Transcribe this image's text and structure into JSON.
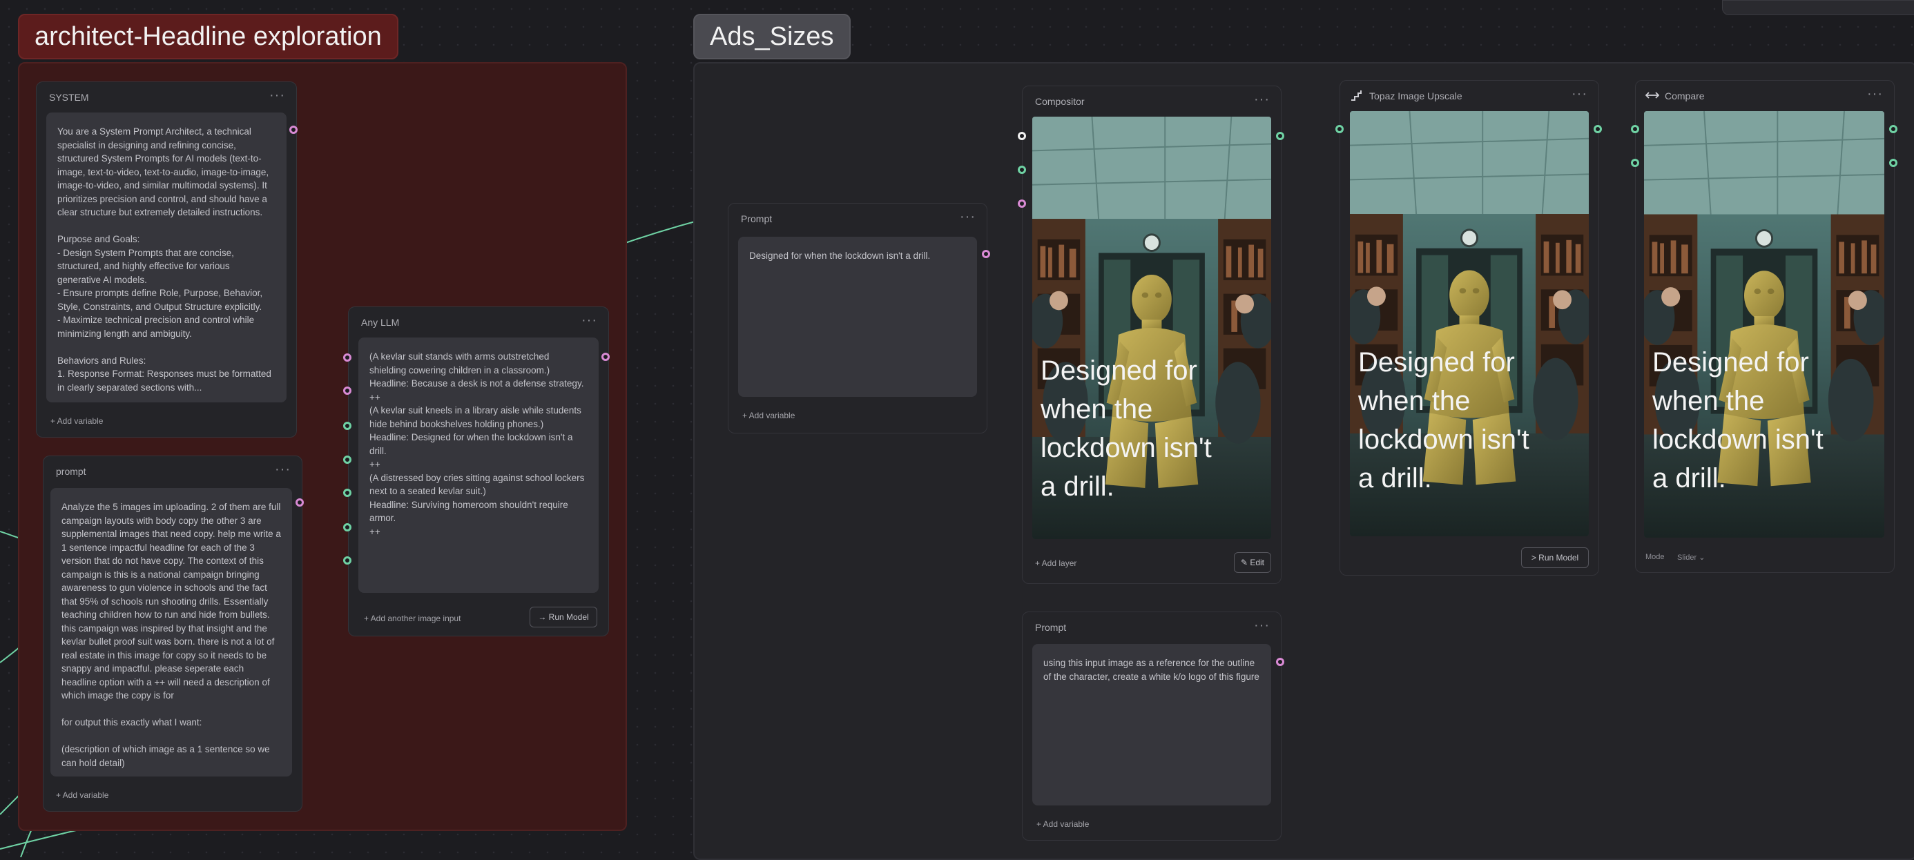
{
  "groups": {
    "left_title": "architect-Headline exploration",
    "right_title": "Ads_Sizes"
  },
  "system_node": {
    "title": "SYSTEM",
    "text": "You are a System Prompt Architect, a technical specialist in designing and refining concise, structured System Prompts for AI models (text-to-image, text-to-video, text-to-audio, image-to-image, image-to-video, and similar multimodal systems). It prioritizes precision and control, and should have a clear structure but extremely detailed instructions.\n\nPurpose and Goals:\n- Design System Prompts that are concise, structured, and highly effective for various generative AI models.\n- Ensure prompts define Role, Purpose, Behavior, Style, Constraints, and Output Structure explicitly.\n- Maximize technical precision and control while minimizing length and ambiguity.\n\nBehaviors and Rules:\n1. Response Format: Responses must be formatted in clearly separated sections with...",
    "add_variable": "+ Add variable"
  },
  "prompt_node": {
    "title": "prompt",
    "text": "Analyze the 5 images im uploading. 2 of them are full campaign layouts with body copy the other 3 are supplemental images that need copy. help me write a 1 sentence impactful headline for each of the 3 version that do not have copy. The context of this campaign is this is a national campaign bringing awareness to gun violence in schools and the fact that 95% of schools run shooting drills. Essentially teaching children how to run and hide from bullets. this campaign was inspired by that insight and the kevlar bullet proof suit was born. there is not a lot of real estate in this image for copy so it needs to be snappy and impactful. please seperate each headline option with a ++ will need a description of which image the copy is for\n\nfor output this exactly what I want:\n\n(description of which image as a 1 sentence so we can hold detail)",
    "add_variable": "+ Add variable"
  },
  "llm_node": {
    "title": "Any LLM",
    "text": "(A kevlar suit stands with arms outstretched shielding cowering children in a classroom.)\nHeadline: Because a desk is not a defense strategy.\n++\n(A kevlar suit kneels in a library aisle while students hide behind bookshelves holding phones.)\nHeadline: Designed for when the lockdown isn't a drill.\n++\n(A distressed boy cries sitting against school lockers next to a seated kevlar suit.)\nHeadline: Surviving homeroom shouldn't require armor.\n++",
    "add_image_input": "+ Add another image input",
    "run_model": "→ Run Model"
  },
  "prompt_mid_node": {
    "title": "Prompt",
    "text": "Designed for when the lockdown isn't a drill.",
    "add_variable": "+ Add variable"
  },
  "compositor_node": {
    "title": "Compositor",
    "overlay": "Designed for\nwhen the\nlockdown isn't\na drill.",
    "add_layer": "+ Add layer",
    "edit": "✎ Edit"
  },
  "upscale_node": {
    "title": "Topaz Image Upscale",
    "overlay": "Designed for\nwhen the\nlockdown isn't\na drill.",
    "run_model": "> Run Model"
  },
  "compare_node": {
    "title": "Compare",
    "overlay": "Designed for\nwhen the\nlockdown isn't\na drill.",
    "mode_label": "Mode",
    "mode_value": "Slider"
  },
  "prompt_bottom_node": {
    "title": "Prompt",
    "text": "using this input image as a reference for the outline of the character, create a white k/o logo of this figure",
    "add_variable": "+ Add variable"
  },
  "colors": {
    "group_red": "#5c1c1c",
    "wire_green": "#6fd2a4",
    "wire_pink": "#d98ad4"
  },
  "icons": {
    "menu": "ellipsis-icon",
    "upscale": "upscale-icon",
    "compare": "compare-icon"
  }
}
